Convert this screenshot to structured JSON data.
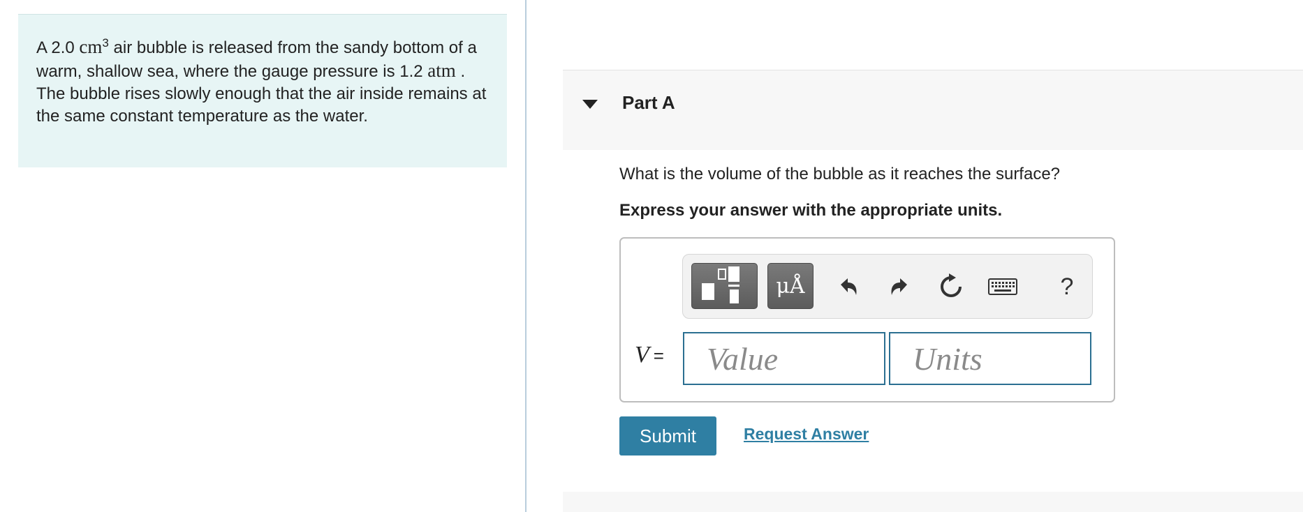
{
  "problem": {
    "prefix": "A 2.0",
    "unit_cm": "cm",
    "unit_exp": "3",
    "text_1": " air bubble is released from the sandy bottom of a warm, shallow sea, where the gauge pressure is 1.2",
    "unit_atm": "atm",
    "text_2": ". The bubble rises slowly enough that the air inside remains at the same constant temperature as the water."
  },
  "part": {
    "title": "Part A",
    "question": "What is the volume of the bubble as it reaches the surface?",
    "instruction": "Express your answer with the appropriate units."
  },
  "toolbar": {
    "units_label": "μÅ",
    "help_label": "?",
    "icons": [
      "templates-icon",
      "units-icon",
      "undo-icon",
      "redo-icon",
      "reset-icon",
      "keyboard-icon",
      "help-icon"
    ]
  },
  "answer": {
    "variable": "V",
    "equals": "=",
    "value_placeholder": "Value",
    "units_placeholder": "Units"
  },
  "actions": {
    "submit_label": "Submit",
    "request_label": "Request Answer"
  },
  "colors": {
    "accent": "#2f7fa3",
    "problem_bg": "#e7f5f5",
    "header_bg": "#f7f7f7"
  }
}
